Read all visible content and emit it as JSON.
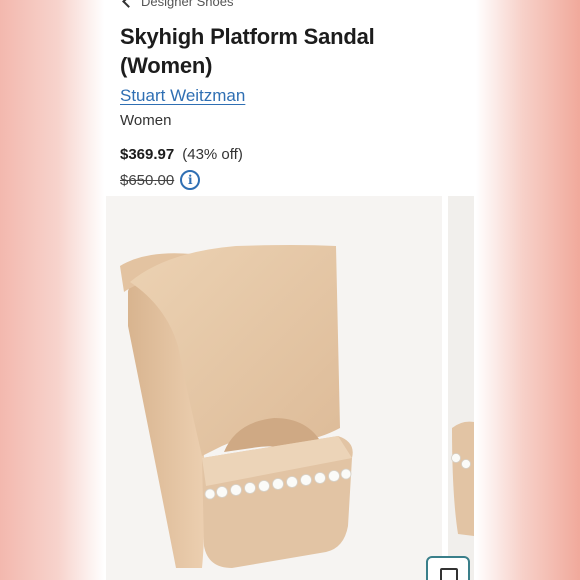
{
  "breadcrumb": {
    "label": "Designer Shoes"
  },
  "product": {
    "title": "Skyhigh Platform Sandal (Women)",
    "brand": "Stuart Weitzman",
    "department": "Women",
    "sale_price": "$369.97",
    "discount": "(43% off)",
    "original_price": "$650.00"
  },
  "icons": {
    "back": "chevron-left-icon",
    "info": "info-icon",
    "menu": "list-icon"
  },
  "colors": {
    "brand_link": "#2f6fb3",
    "shoe_suede": "#e7c9a8",
    "background_pink": "#f3b8ae"
  }
}
